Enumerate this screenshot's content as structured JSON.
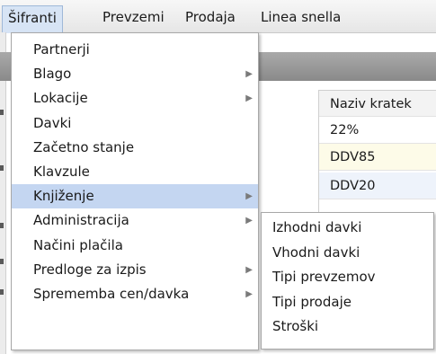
{
  "menubar": {
    "items": [
      {
        "label": "Šifranti"
      },
      {
        "label": "Prevzemi"
      },
      {
        "label": "Prodaja"
      },
      {
        "label": "Linea snella"
      }
    ]
  },
  "background_table": {
    "column_header": "Naziv kratek",
    "cells": [
      "22%",
      "DDV85",
      "DDV20"
    ]
  },
  "main_menu": {
    "items": [
      {
        "label": "Partnerji",
        "has_submenu": false
      },
      {
        "label": "Blago",
        "has_submenu": true
      },
      {
        "label": "Lokacije",
        "has_submenu": true
      },
      {
        "label": "Davki",
        "has_submenu": false
      },
      {
        "label": "Začetno stanje",
        "has_submenu": false
      },
      {
        "label": "Klavzule",
        "has_submenu": false
      },
      {
        "label": "Knjiženje",
        "has_submenu": true,
        "highlighted": true
      },
      {
        "label": "Administracija",
        "has_submenu": true
      },
      {
        "label": "Načini plačila",
        "has_submenu": false
      },
      {
        "label": "Predloge za izpis",
        "has_submenu": true
      },
      {
        "label": "Sprememba cen/davka",
        "has_submenu": true
      }
    ],
    "submenu_arrow_icon": "triangle-right-icon"
  },
  "submenu": {
    "parent": "Knjiženje",
    "items": [
      {
        "label": "Izhodni davki"
      },
      {
        "label": "Vhodni davki"
      },
      {
        "label": "Tipi prevzemov"
      },
      {
        "label": "Tipi prodaje"
      },
      {
        "label": "Stroški"
      }
    ]
  },
  "colors": {
    "highlight": "#c4d6f1",
    "active_menubar": "#d7e4f5"
  }
}
